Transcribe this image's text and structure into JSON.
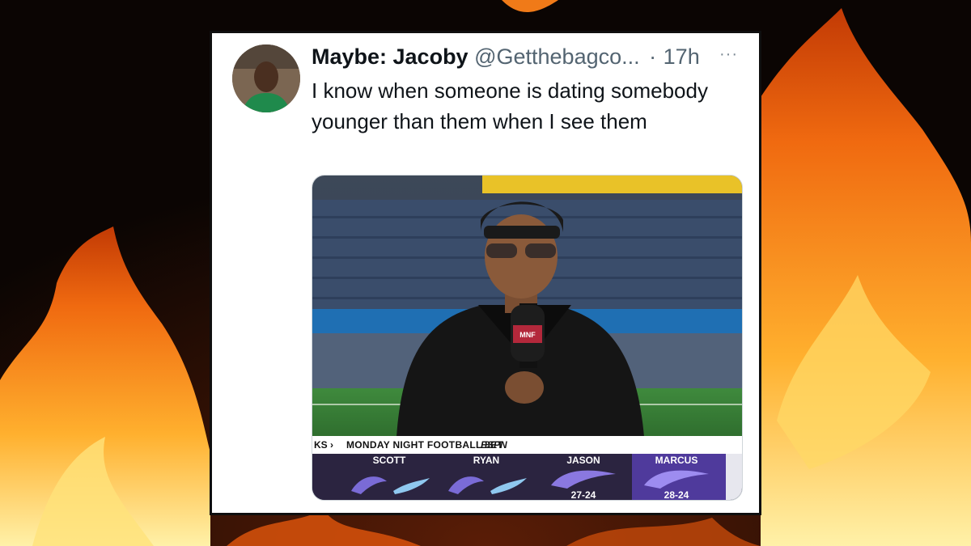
{
  "tweet": {
    "author_name": "Maybe: Jacoby",
    "author_handle": "@Getthebagco...",
    "separator": "·",
    "time": "17h",
    "more": "···",
    "text": "I know when someone is dating somebody younger than them when I see them"
  },
  "broadcast": {
    "ticker_prefix": "KS ›",
    "show_title": "MONDAY NIGHT FOOTBALL",
    "time": "8ET",
    "network": "ESPN",
    "mic_flag": "MNF",
    "picks": [
      {
        "name": "SCOTT",
        "logo": "ravens-vs-chargers-icon",
        "score": ""
      },
      {
        "name": "RYAN",
        "logo": "ravens-vs-chargers-icon",
        "score": ""
      },
      {
        "name": "JASON",
        "logo": "ravens-icon",
        "score": "27-24"
      },
      {
        "name": "MARCUS",
        "logo": "ravens-icon",
        "score": "28-24"
      }
    ]
  },
  "colors": {
    "card_background": "#ffffff",
    "text_primary": "#0f1419",
    "text_secondary": "#536471",
    "ticker_panel": "#2b2440",
    "highlight_panel": "#4f3a9c"
  }
}
